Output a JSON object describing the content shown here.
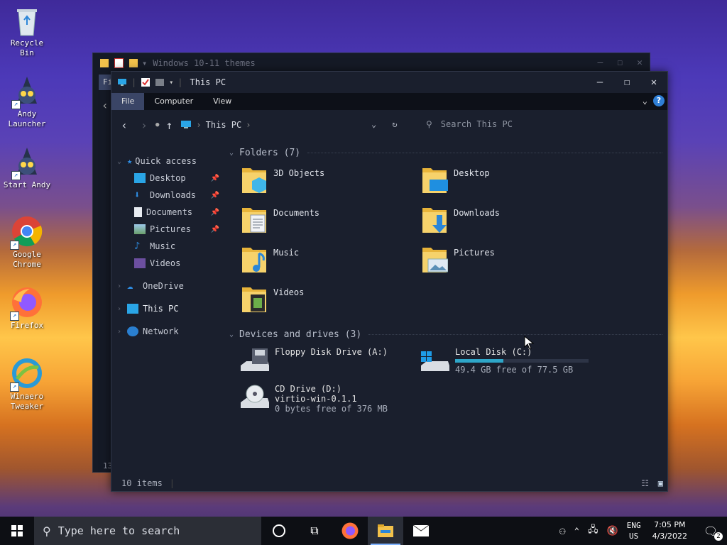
{
  "desktop": {
    "icons": [
      {
        "label": "Recycle\nBin"
      },
      {
        "label": "Andy\nLauncher"
      },
      {
        "label": "Start Andy"
      },
      {
        "label": "Google\nChrome"
      },
      {
        "label": "Firefox"
      },
      {
        "label": "Winaero\nTweaker"
      }
    ]
  },
  "back_window": {
    "title": "Windows 10-11 themes",
    "tab_fragment": "Fi",
    "status_fragment": "13"
  },
  "window": {
    "title": "This PC",
    "ribbon_tabs": [
      "File",
      "Computer",
      "View"
    ],
    "address": {
      "crumb": "This PC",
      "separator": "›",
      "search_placeholder": "Search This PC"
    },
    "nav_pane": {
      "quick_access": "Quick access",
      "quick_items": [
        "Desktop",
        "Downloads",
        "Documents",
        "Pictures",
        "Music",
        "Videos"
      ],
      "onedrive": "OneDrive",
      "this_pc": "This PC",
      "network": "Network"
    },
    "folders_header": "Folders (7)",
    "folders": [
      "3D Objects",
      "Desktop",
      "Documents",
      "Downloads",
      "Music",
      "Pictures",
      "Videos"
    ],
    "drives_header": "Devices and drives (3)",
    "drives": [
      {
        "name": "Floppy Disk Drive (A:)"
      },
      {
        "name": "Local Disk (C:)",
        "free": "49.4 GB free of 77.5 GB",
        "used_fraction": 0.36
      },
      {
        "name": "CD Drive (D:)",
        "label": "virtio-win-0.1.1",
        "free": "0 bytes free of 376 MB"
      }
    ],
    "status": "10 items"
  },
  "taskbar": {
    "search_placeholder": "Type here to search",
    "lang_1": "ENG",
    "lang_2": "US",
    "time": "7:05 PM",
    "date": "4/3/2022",
    "notification_count": "2"
  }
}
